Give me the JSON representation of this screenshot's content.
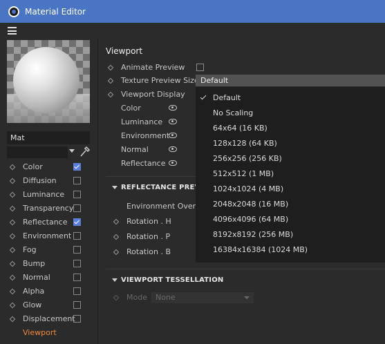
{
  "window": {
    "title": "Material Editor"
  },
  "material": {
    "name": "Mat"
  },
  "channels": [
    {
      "label": "Color",
      "checked": true
    },
    {
      "label": "Diffusion",
      "checked": false
    },
    {
      "label": "Luminance",
      "checked": false
    },
    {
      "label": "Transparency",
      "checked": false
    },
    {
      "label": "Reflectance",
      "checked": true
    },
    {
      "label": "Environment",
      "checked": false
    },
    {
      "label": "Fog",
      "checked": false
    },
    {
      "label": "Bump",
      "checked": false
    },
    {
      "label": "Normal",
      "checked": false
    },
    {
      "label": "Alpha",
      "checked": false
    },
    {
      "label": "Glow",
      "checked": false
    },
    {
      "label": "Displacement",
      "checked": false
    },
    {
      "label": "Viewport",
      "active": true
    }
  ],
  "viewport": {
    "title": "Viewport",
    "animate_preview_label": "Animate Preview",
    "texture_preview_size_label": "Texture Preview Size",
    "texture_preview_size_value": "Default",
    "viewport_display_label": "Viewport Display",
    "display_items": [
      "Color",
      "Luminance",
      "Environment",
      "Normal",
      "Reflectance"
    ]
  },
  "reflectance_preview": {
    "header": "REFLECTANCE PREVIEW",
    "environment_override_label": "Environment Override",
    "rotation_h_label": "Rotation . H",
    "rotation_p_label": "Rotation . P",
    "rotation_b_label": "Rotation . B"
  },
  "viewport_tessellation": {
    "header": "VIEWPORT TESSELLATION",
    "mode_label": "Mode",
    "mode_value": "None"
  },
  "dropdown": {
    "selected": "Default",
    "options": [
      "Default",
      "No Scaling",
      "64x64 (16 KB)",
      "128x128 (64 KB)",
      "256x256 (256 KB)",
      "512x512 (1 MB)",
      "1024x1024 (4 MB)",
      "2048x2048 (16 MB)",
      "4096x4096 (64 MB)",
      "8192x8192 (256 MB)",
      "16384x16384 (1024 MB)"
    ]
  },
  "colors": {
    "titlebar": "#4a74c4",
    "checkbox_on": "#5b7fd6",
    "active_channel": "#f08a3c",
    "dropdown_bg": "#1e1e1e"
  }
}
